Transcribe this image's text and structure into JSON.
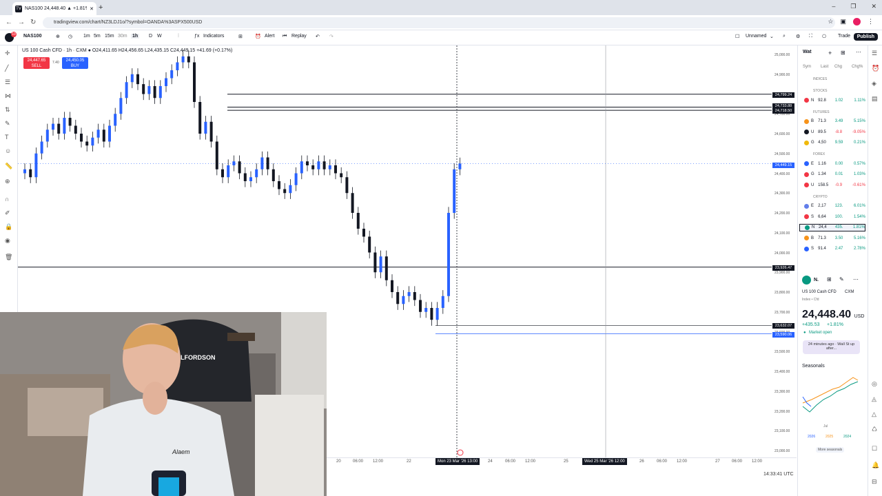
{
  "browser": {
    "tab_title": "NAS100 24,448.40 ▲ +1.81% ...",
    "new_tab": "+",
    "url": "tradingview.com/chart/NZ3LDJ1o/?symbol=OANDA%3ASPX500USD",
    "win_controls": [
      "–",
      "❐",
      "✕"
    ]
  },
  "toolbar": {
    "symbol": "NAS100",
    "intervals": [
      "1m",
      "5m",
      "15m",
      "30m",
      "1h",
      "D",
      "W"
    ],
    "indicators": "Indicators",
    "alert": "Alert",
    "replay": "Replay",
    "layout_name": "Unnamed",
    "trade": "Trade",
    "publish": "Publish",
    "notification_count": "10"
  },
  "legend": {
    "text": "US 100 Cash CFD · 1h · CXM  ●  O24,411.65 H24,456.65 L24,435.15 C24,449.15 +41.69 (+0.17%)",
    "sell_price": "24,447.65",
    "sell_label": "SELL",
    "spread": "7.40",
    "buy_price": "24,450.05",
    "buy_label": "BUY"
  },
  "price_axis": {
    "ticks": [
      "25,000.00",
      "24,900.00",
      "24,800.00",
      "24,700.00",
      "24,600.00",
      "24,500.00",
      "24,400.00",
      "24,300.00",
      "24,200.00",
      "24,100.00",
      "24,000.00",
      "23,900.00",
      "23,800.00",
      "23,700.00",
      "23,600.00",
      "23,500.00",
      "23,400.00",
      "23,300.00",
      "23,200.00",
      "23,100.00",
      "23,000.00"
    ],
    "labels": [
      "24,799.24",
      "24,733.88",
      "24,718.50",
      "24,449.15",
      "23,926.47",
      "23,632.07",
      "23,590.06"
    ]
  },
  "time_axis": {
    "ticks": [
      "20",
      "06:00",
      "12:00",
      "22",
      "24",
      "06:00",
      "12:00",
      "25",
      "26",
      "06:00",
      "12:00",
      "27",
      "06:00",
      "12:00"
    ],
    "crosshair_label": "Mon 23 Mar '26  13:00",
    "crosshair_label2": "Wed 25 Mar '26  12:00",
    "clock": "14:33:41 UTC"
  },
  "colors": {
    "up": "#2962ff",
    "down": "#131722",
    "sell": "#f23645",
    "buy": "#2962ff"
  },
  "watchlist": {
    "title": "Wat",
    "columns": [
      "Sym",
      "Last",
      "Chg",
      "Chg%"
    ],
    "sections": [
      {
        "name": "INDICES",
        "rows": []
      },
      {
        "name": "STOCKS",
        "rows": [
          {
            "sym": "N",
            "last": "92.8",
            "chg": "1.02",
            "pct": "1.11%",
            "color": "#f23645",
            "dir": "up"
          }
        ]
      },
      {
        "name": "FUTURES",
        "rows": [
          {
            "sym": "B",
            "last": "71.3",
            "chg": "3.49",
            "pct": "5.15%",
            "color": "#f7931a",
            "dir": "up"
          },
          {
            "sym": "U",
            "last": "89.5",
            "chg": "-8.8",
            "pct": "-9.05%",
            "color": "#131722",
            "dir": "dn"
          },
          {
            "sym": "G",
            "last": "4,50",
            "chg": "9.59",
            "pct": "0.21%",
            "color": "#f0b90b",
            "dir": "up"
          }
        ]
      },
      {
        "name": "FOREX",
        "rows": [
          {
            "sym": "E",
            "last": "1.16",
            "chg": "0.00",
            "pct": "0.57%",
            "color": "#2962ff",
            "dir": "up"
          },
          {
            "sym": "G",
            "last": "1.34",
            "chg": "0.01",
            "pct": "1.03%",
            "color": "#f23645",
            "dir": "up"
          },
          {
            "sym": "U",
            "last": "158.5",
            "chg": "-0.9",
            "pct": "-0.61%",
            "color": "#f23645",
            "dir": "dn"
          }
        ]
      },
      {
        "name": "CRYPTO",
        "rows": [
          {
            "sym": "E",
            "last": "2,17",
            "chg": "123.",
            "pct": "6.01%",
            "color": "#627eea",
            "dir": "up"
          },
          {
            "sym": "S",
            "last": "6,64",
            "chg": "100.",
            "pct": "1.54%",
            "color": "#f23645",
            "dir": "up"
          },
          {
            "sym": "N",
            "last": "24,4",
            "chg": "435.",
            "pct": "1.81%",
            "color": "#089981",
            "dir": "up"
          },
          {
            "sym": "B",
            "last": "71.3",
            "chg": "3.50",
            "pct": "5.16%",
            "color": "#f7931a",
            "dir": "up"
          },
          {
            "sym": "S",
            "last": "91.4",
            "chg": "2.47",
            "pct": "2.78%",
            "color": "#2962ff",
            "dir": "up"
          }
        ]
      }
    ]
  },
  "details": {
    "symbol_short": "N.",
    "name": "US 100 Cash CFD",
    "exchange": "CXM",
    "sub": "Index • Cfd",
    "price_main": "24,448",
    "price_dec": ".40",
    "currency": "USD",
    "change": "+435.53",
    "change_pct": "+1.81%",
    "market_status": "Market open",
    "news": "24 minutes ago · Wall St up after...",
    "seasonals_title": "Seasonals",
    "seasonals_month": "Jul",
    "seasonals_legend": [
      "2026",
      "2025",
      "2024"
    ],
    "more_seasonals": "More seasonals"
  },
  "webcam": {
    "chair_brand": "LFORDSON",
    "shirt_text": "Alaem"
  }
}
